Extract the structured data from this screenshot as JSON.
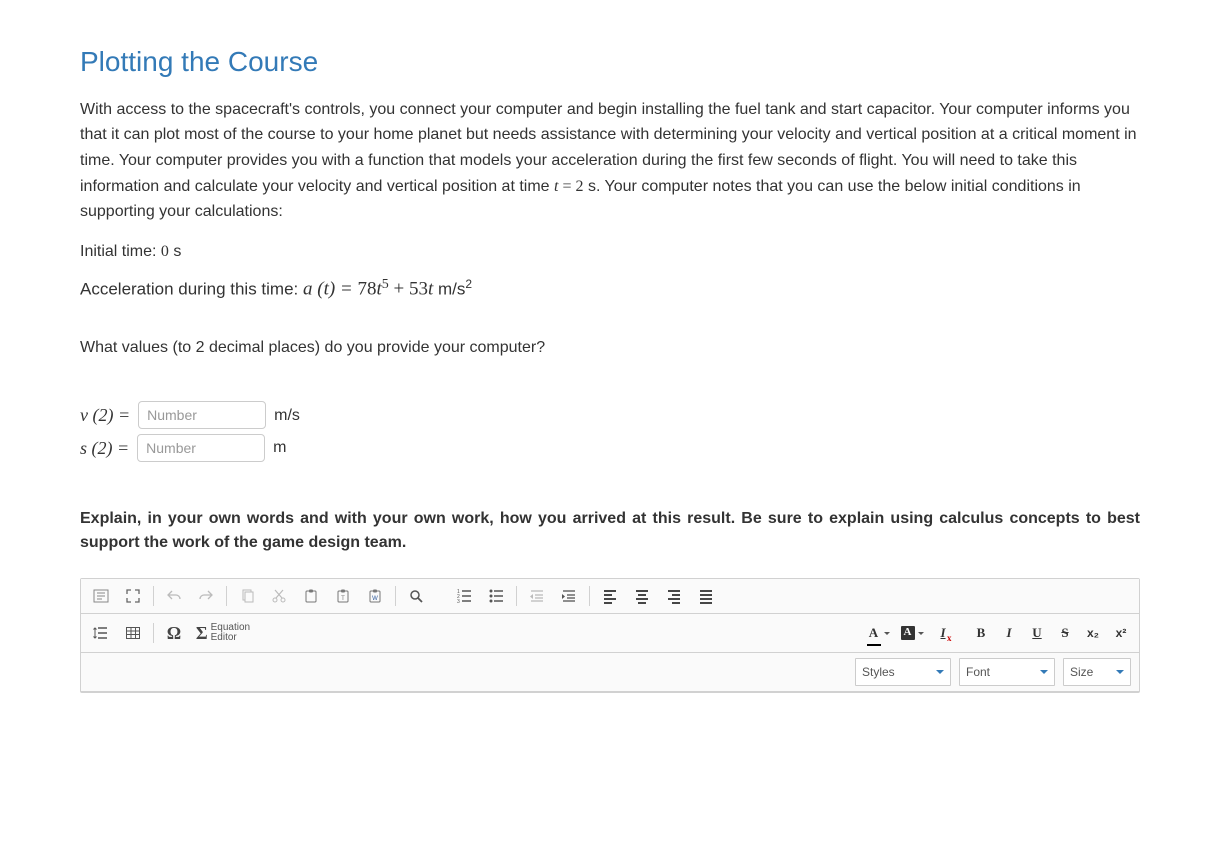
{
  "title": "Plotting the Course",
  "body": "With access to the spacecraft's controls, you connect your computer and begin installing the fuel tank and start capacitor. Your computer informs you that it can plot most of the course to your home planet but needs assistance with determining your velocity and vertical position at a critical moment in time. Your computer provides you with a function that models your acceleration during the first few seconds of flight. You will need to take this information and calculate your velocity and vertical position at time ",
  "body_math_t": "t",
  "body_math_eq": " = ",
  "body_math_val": "2",
  "body_after": " s. Your computer notes that you can use the below initial conditions in supporting your calculations:",
  "initial_time_label": "Initial time: ",
  "initial_time_value": "0",
  "initial_time_unit": " s",
  "accel_label": "Acceleration during this time: ",
  "accel_lhs": "a (t) = ",
  "accel_c1": "78",
  "accel_var1": "t",
  "accel_exp1": "5",
  "accel_plus": " + ",
  "accel_c2": "53",
  "accel_var2": "t",
  "accel_unit": " m/s",
  "accel_unit_exp": "2",
  "question": "What values (to 2 decimal places) do you provide your computer?",
  "answers": {
    "v_lhs": "v (2) = ",
    "v_placeholder": "Number",
    "v_unit": "m/s",
    "s_lhs": "s (2) = ",
    "s_placeholder": "Number",
    "s_unit": "m"
  },
  "explain_prompt": "Explain, in your own words and with your own work, how you arrived at this result. Be sure to explain using calculus concepts to best support the work of the game design team.",
  "editor": {
    "equation_label_1": "Equation",
    "equation_label_2": "Editor",
    "combo_styles": "Styles",
    "combo_font": "Font",
    "combo_size": "Size",
    "btn_bold": "B",
    "btn_italic": "I",
    "btn_underline": "U",
    "btn_strike": "S",
    "btn_sub": "x₂",
    "btn_sup": "x²",
    "omega": "Ω",
    "sigma": "Σ"
  }
}
